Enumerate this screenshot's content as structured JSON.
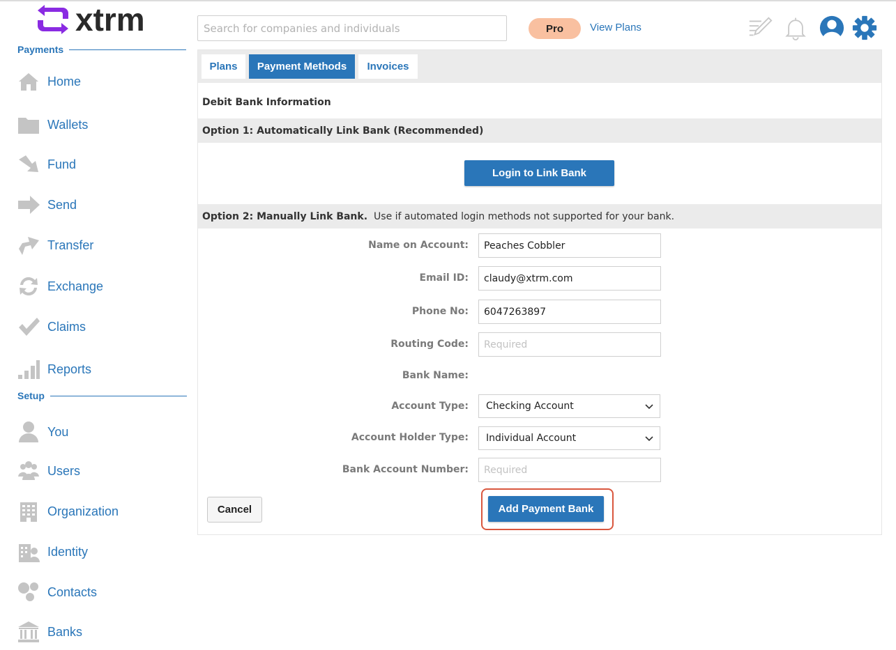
{
  "app": {
    "logo_text": "xtrm"
  },
  "header": {
    "search_placeholder": "Search for companies and individuals",
    "plan_badge": "Pro",
    "view_plans": "View Plans"
  },
  "sidebar": {
    "payments_heading": "Payments",
    "payments_items": [
      {
        "label": "Home",
        "icon": "home-icon"
      },
      {
        "label": "Wallets",
        "icon": "folder-icon"
      },
      {
        "label": "Fund",
        "icon": "fund-arrow-icon"
      },
      {
        "label": "Send",
        "icon": "send-arrow-icon"
      },
      {
        "label": "Transfer",
        "icon": "transfer-arrow-icon"
      },
      {
        "label": "Exchange",
        "icon": "exchange-icon"
      },
      {
        "label": "Claims",
        "icon": "checkmark-icon"
      },
      {
        "label": "Reports",
        "icon": "bar-chart-icon"
      }
    ],
    "setup_heading": "Setup",
    "setup_items": [
      {
        "label": "You",
        "icon": "person-icon"
      },
      {
        "label": "Users",
        "icon": "users-icon"
      },
      {
        "label": "Organization",
        "icon": "building-icon"
      },
      {
        "label": "Identity",
        "icon": "identity-icon"
      },
      {
        "label": "Contacts",
        "icon": "contacts-icon"
      },
      {
        "label": "Banks",
        "icon": "bank-icon"
      }
    ]
  },
  "tabs": [
    {
      "label": "Plans",
      "active": false
    },
    {
      "label": "Payment Methods",
      "active": true
    },
    {
      "label": "Invoices",
      "active": false
    }
  ],
  "content": {
    "section_title": "Debit Bank Information",
    "option1_title": "Option 1: Automatically Link Bank (Recommended)",
    "login_button": "Login to Link Bank",
    "option2_title": "Option 2: Manually Link Bank.",
    "option2_note": "Use if automated login methods not supported for your bank."
  },
  "form": {
    "name_label": "Name on Account:",
    "name_value": "Peaches Cobbler",
    "email_label": "Email ID:",
    "email_value": "claudy@xtrm.com",
    "phone_label": "Phone No:",
    "phone_value": "6047263897",
    "routing_label": "Routing Code:",
    "routing_placeholder": "Required",
    "bank_name_label": "Bank Name:",
    "account_type_label": "Account Type:",
    "account_type_value": "Checking Account",
    "holder_type_label": "Account Holder Type:",
    "holder_type_value": "Individual Account",
    "account_number_label": "Bank Account Number:",
    "account_number_placeholder": "Required"
  },
  "actions": {
    "cancel": "Cancel",
    "add_payment_bank": "Add Payment Bank"
  },
  "colors": {
    "brand_blue": "#2a76b9",
    "logo_purple": "#8a2be2",
    "pro_badge": "#f9c0a0",
    "highlight_ring": "#d9573e",
    "icon_gray": "#c4c4c4"
  }
}
